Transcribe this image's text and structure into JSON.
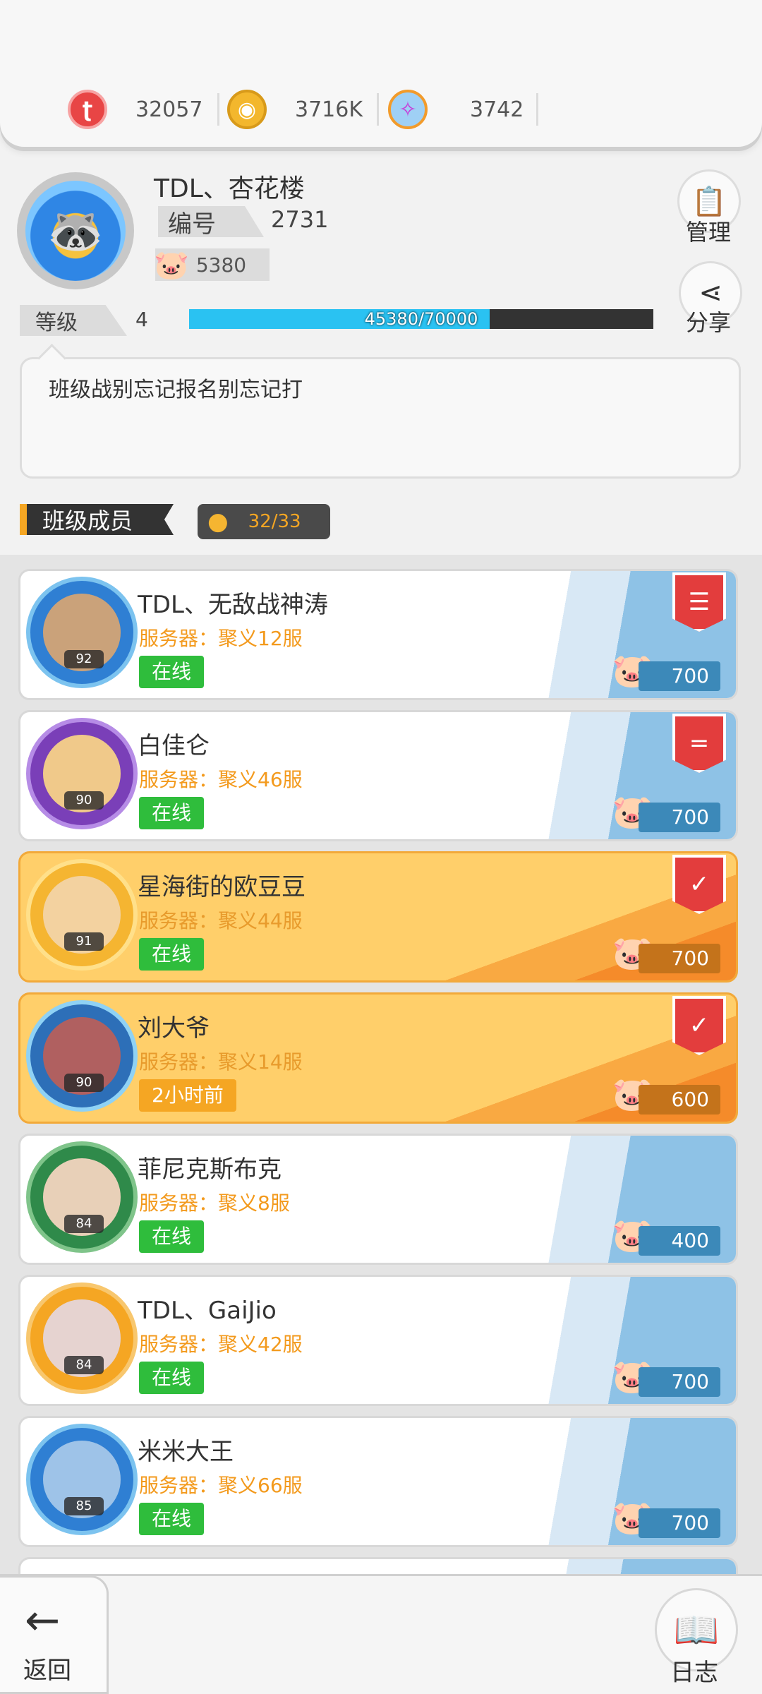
{
  "currencies": [
    {
      "icon": "gem-coin-icon",
      "value": "32057"
    },
    {
      "icon": "gold-coin-icon",
      "value": "3716K"
    },
    {
      "icon": "pacifier-icon",
      "value": "3742"
    }
  ],
  "profile": {
    "name": "TDL、杏花楼",
    "id_label": "编号",
    "id_value": "2731",
    "pig_value": "5380",
    "level_label": "等级",
    "level_value": "4",
    "exp_text": "45380/70000",
    "exp_fraction": 0.648,
    "notice": "班级战别忘记报名别忘记打"
  },
  "side_buttons": {
    "manage_label": "管理",
    "share_label": "分享"
  },
  "members_section": {
    "title": "班级成员",
    "count": "32/33"
  },
  "members": [
    {
      "name": "TDL、无敌战神涛",
      "level": "92",
      "server": "服务器：聚义12服",
      "status": "在线",
      "online": true,
      "contribution": "700",
      "badge": "leader",
      "gold": false
    },
    {
      "name": "白佳仑",
      "level": "90",
      "server": "服务器：聚义46服",
      "status": "在线",
      "online": true,
      "contribution": "700",
      "badge": "vice",
      "gold": false
    },
    {
      "name": "星海街的欧豆豆",
      "level": "91",
      "server": "服务器：聚义44服",
      "status": "在线",
      "online": true,
      "contribution": "700",
      "badge": "elite",
      "gold": true
    },
    {
      "name": "刘大爷",
      "level": "90",
      "server": "服务器：聚义14服",
      "status": "2小时前",
      "online": false,
      "contribution": "600",
      "badge": "elite",
      "gold": true
    },
    {
      "name": "菲尼克斯布克",
      "level": "84",
      "server": "服务器：聚义8服",
      "status": "在线",
      "online": true,
      "contribution": "400",
      "badge": "",
      "gold": false
    },
    {
      "name": "TDL、GaiJio",
      "level": "84",
      "server": "服务器：聚义42服",
      "status": "在线",
      "online": true,
      "contribution": "700",
      "badge": "",
      "gold": false
    },
    {
      "name": "米米大王",
      "level": "85",
      "server": "服务器：聚义66服",
      "status": "在线",
      "online": true,
      "contribution": "700",
      "badge": "",
      "gold": false
    }
  ],
  "bottom": {
    "back_label": "返回",
    "log_label": "日志"
  }
}
